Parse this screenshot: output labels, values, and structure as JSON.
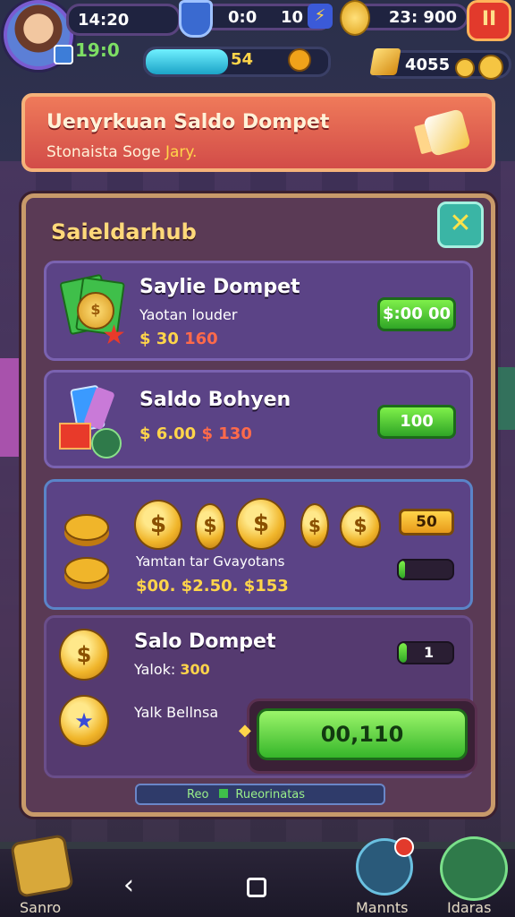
{
  "hud": {
    "time": "14:20",
    "mid_left": "0:0",
    "mid_right": "10",
    "coins": "23: 900",
    "pause_label": "II",
    "level": "19:0",
    "xp_value": "54",
    "xp_progress": 0.45,
    "gems": "4055"
  },
  "banner": {
    "title": "Uenyrkuan Saldo Dompet",
    "subtitle_start": "Stonaista Soge",
    "subtitle_highlight": "Jary."
  },
  "panel": {
    "title": "Saieldarhub",
    "close_label": "✕",
    "cards": [
      {
        "title": "Saylie Dompet",
        "subtitle": "Yaotan louder",
        "price_gold": "$ 30",
        "price_red": "160",
        "button": "$:00 00"
      },
      {
        "title": "Saldo Bohyen",
        "price_gold": "$ 6.00",
        "price_red": "$ 130",
        "button": "100"
      },
      {
        "subtitle": "Yamtan  tar  Gvayotans",
        "prices": "$00. $2.50. $153",
        "tag": "50",
        "bar_progress": 0.12
      },
      {
        "title": "Salo Dompet",
        "subtitle_label": "Yalok: ",
        "subtitle_value": "300",
        "bar_label": "1",
        "bar_progress": 0.15,
        "side_label": "Yalk Bellnsa",
        "button": "00,110"
      }
    ],
    "footer_left": "Reo",
    "footer_right": "Rueorinatas"
  },
  "nav": {
    "store_label": "Sanro",
    "manuals_label": "Mannts",
    "ideas_label": "Idaras"
  },
  "colors": {
    "accent_green": "#3fbf4a",
    "gold": "#ffd54a",
    "banner_red": "#d24c48",
    "panel_bg": "#5a3a55"
  }
}
